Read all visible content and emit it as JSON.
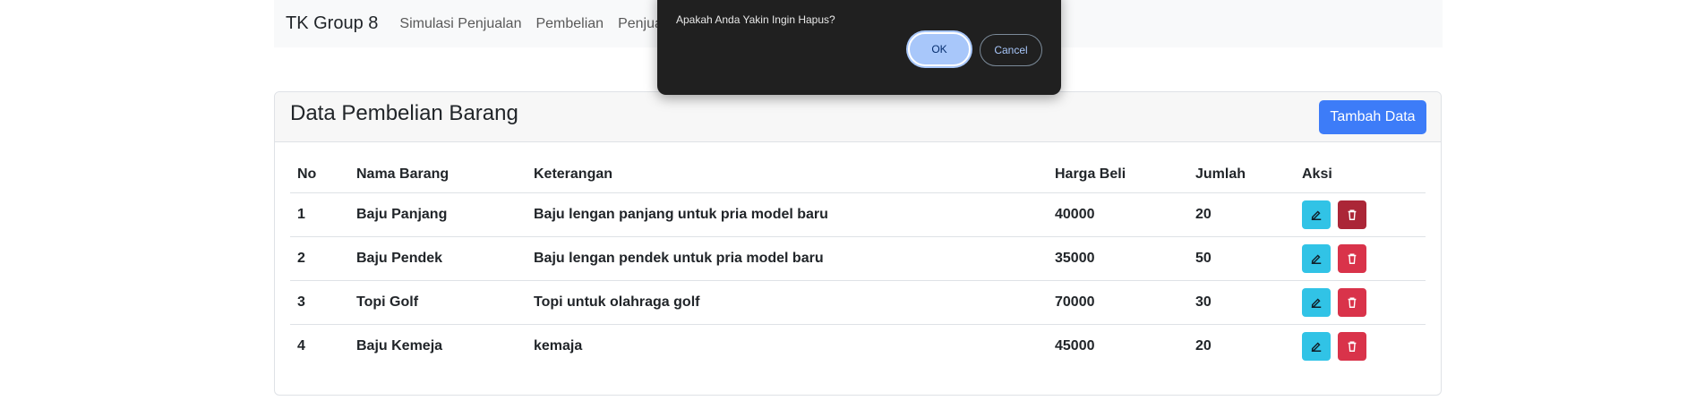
{
  "navbar": {
    "brand": "TK Group 8",
    "links": [
      "Simulasi Penjualan",
      "Pembelian",
      "Penjualan"
    ]
  },
  "card": {
    "title": "Data Pembelian Barang",
    "add_button": "Tambah Data"
  },
  "table": {
    "headers": [
      "No",
      "Nama Barang",
      "Keterangan",
      "Harga Beli",
      "Jumlah",
      "Aksi"
    ],
    "rows": [
      {
        "no": "1",
        "nama": "Baju Panjang",
        "keterangan": "Baju lengan panjang untuk pria model baru",
        "harga": "40000",
        "jumlah": "20"
      },
      {
        "no": "2",
        "nama": "Baju Pendek",
        "keterangan": "Baju lengan pendek untuk pria model baru",
        "harga": "35000",
        "jumlah": "50"
      },
      {
        "no": "3",
        "nama": "Topi Golf",
        "keterangan": "Topi untuk olahraga golf",
        "harga": "70000",
        "jumlah": "30"
      },
      {
        "no": "4",
        "nama": "Baju Kemeja",
        "keterangan": "kemaja",
        "harga": "45000",
        "jumlah": "20"
      }
    ]
  },
  "dialog": {
    "message": "Apakah Anda Yakin Ingin Hapus?",
    "ok_label": "OK",
    "cancel_label": "Cancel"
  },
  "icons": {
    "edit": "edit-icon",
    "delete": "trash-icon"
  },
  "colors": {
    "primary": "#3d7cf8",
    "edit_button": "#31c3e6",
    "delete_button": "#d9334a",
    "dialog_bg": "#202020"
  }
}
